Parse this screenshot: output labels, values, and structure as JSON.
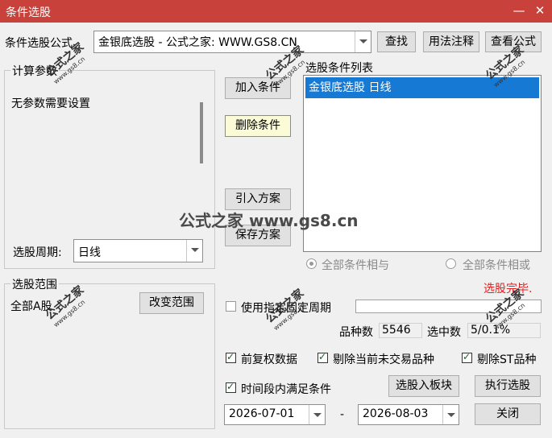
{
  "window": {
    "title": "条件选股",
    "min_icon": "minimize-icon",
    "close_icon": "close-icon"
  },
  "formula": {
    "label": "条件选股公式",
    "value": "金银底选股  -  公式之家: WWW.GS8.CN",
    "find_button": "查找",
    "usage_button": "用法注释",
    "view_button": "查看公式"
  },
  "params": {
    "legend": "计算参数",
    "text": "无参数需要设置",
    "period_label": "选股周期:",
    "period_value": "日线"
  },
  "actions": {
    "add_condition": "加入条件",
    "delete_condition": "删除条件",
    "import_plan": "引入方案",
    "save_plan": "保存方案"
  },
  "condition_list": {
    "label": "选股条件列表",
    "items": [
      "金银底选股  日线"
    ],
    "radio_and": "全部条件相与",
    "radio_or": "全部条件相或",
    "status": "选股完毕."
  },
  "scope": {
    "legend": "选股范围",
    "value": "全部A股",
    "change_button": "改变范围"
  },
  "options": {
    "use_fixed_period": "使用指定固定周期",
    "count_label": "品种数",
    "count_value": "5546",
    "selected_label": "选中数",
    "selected_value": "5/0.1%",
    "pre_rights": "前复权数据",
    "exclude_untraded": "剔除当前未交易品种",
    "exclude_st": "剔除ST品种",
    "time_range": "时间段内满足条件",
    "to_block_button": "选股入板块",
    "execute_button": "执行选股",
    "start_date": "2026-07-01",
    "dash": "-",
    "end_date": "2026-08-03",
    "close_button": "关闭"
  },
  "watermark": {
    "main": "公式之家 www.gs8.cn",
    "stamp_a": "公式之家",
    "stamp_b": "www.gs8.cn"
  }
}
